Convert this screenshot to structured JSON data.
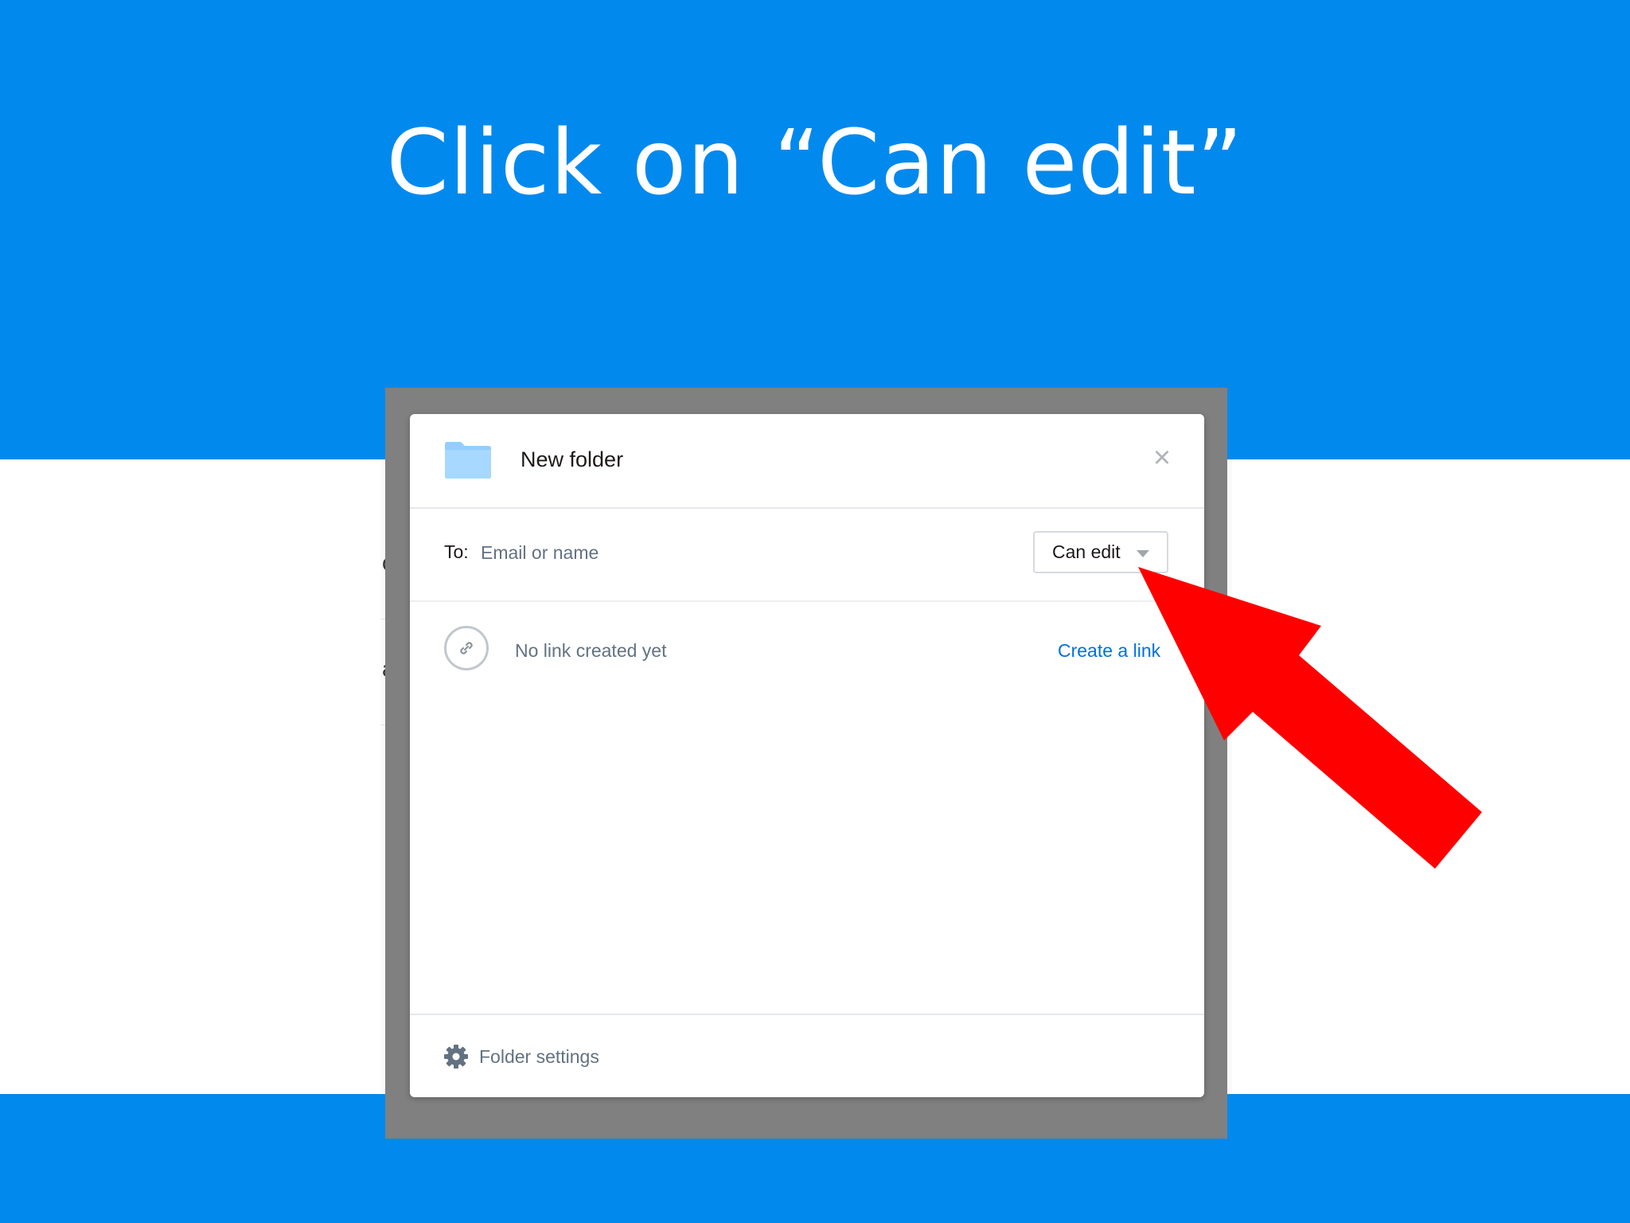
{
  "slide": {
    "title": "Click on “Can edit”"
  },
  "background_app": {
    "row_fragments": [
      "old",
      "art"
    ]
  },
  "modal": {
    "title": "New folder",
    "close_icon": "close-icon",
    "share": {
      "to_label": "To:",
      "email_placeholder": "Email or name",
      "permission_value": "Can edit"
    },
    "link": {
      "status": "No link created yet",
      "create_label": "Create a link"
    },
    "footer": {
      "settings_label": "Folder settings"
    }
  },
  "colors": {
    "slide_blue": "#0289ee",
    "overlay_gray": "#808080",
    "folder_blue": "#92ceff",
    "link_blue": "#0070e0",
    "arrow_red": "#ff0000"
  }
}
